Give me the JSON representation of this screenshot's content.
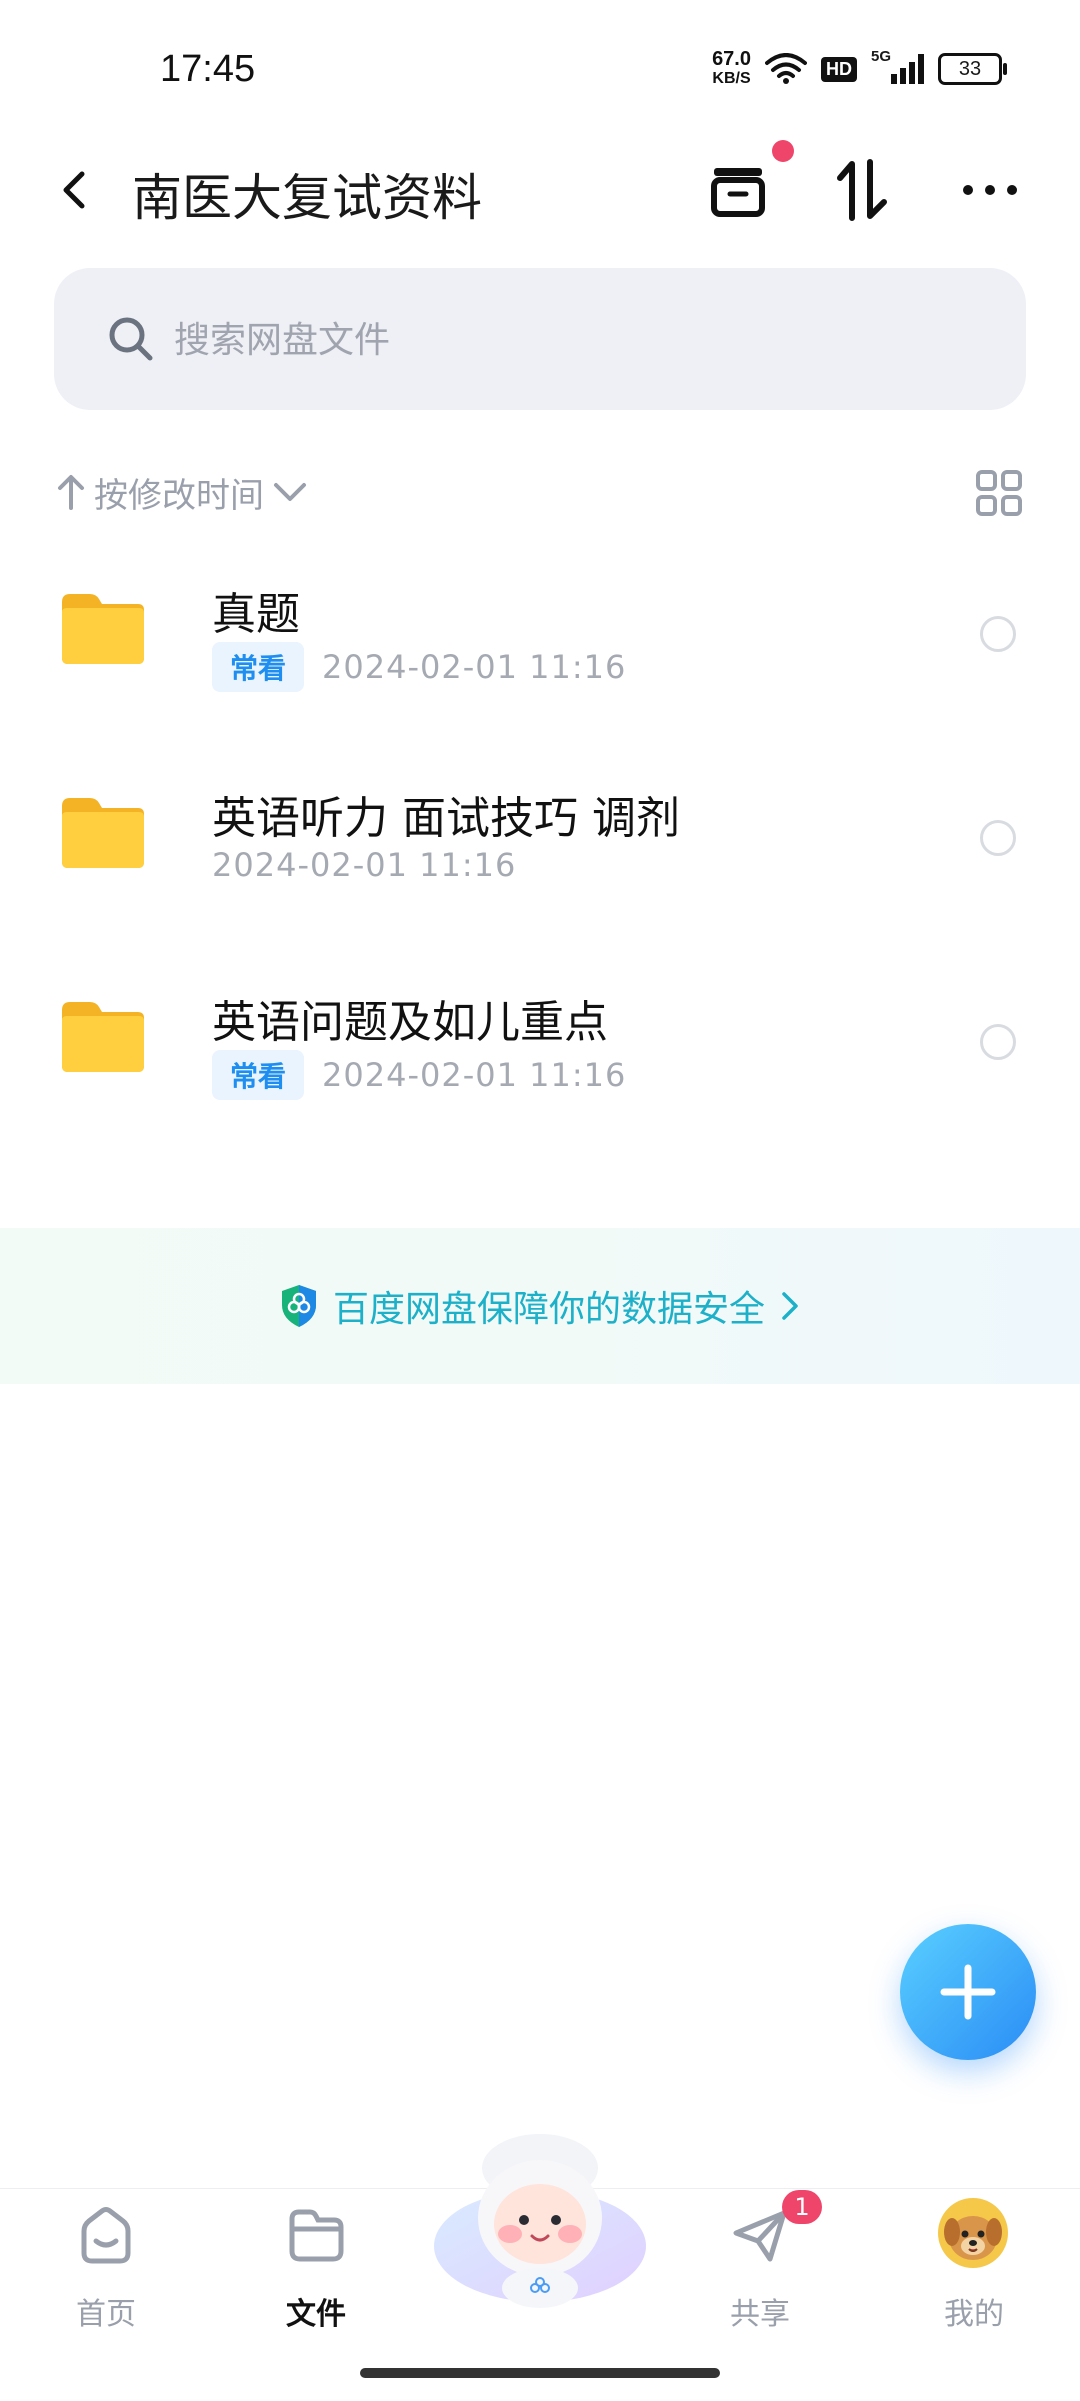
{
  "status_bar": {
    "time": "17:45",
    "net_speed": "67.0",
    "net_speed_unit": "KB/S",
    "hd_label": "HD",
    "signal_label": "5G",
    "battery": "33"
  },
  "header": {
    "title": "南医大复试资料",
    "icons": [
      "back-icon",
      "archive-icon",
      "sort-arrows-icon",
      "more-icon"
    ]
  },
  "search": {
    "placeholder": "搜索网盘文件"
  },
  "sort": {
    "label": "按修改时间"
  },
  "files": [
    {
      "name": "真题",
      "tag": "常看",
      "date": "2024-02-01  11:16"
    },
    {
      "name": "英语听力 面试技巧 调剂",
      "tag": "",
      "date": "2024-02-01  11:16"
    },
    {
      "name": "英语问题及如儿重点",
      "tag": "常看",
      "date": "2024-02-01  11:16"
    }
  ],
  "banner": {
    "text": "百度网盘保障你的数据安全"
  },
  "bottom_nav": {
    "home": "首页",
    "files": "文件",
    "share": "共享",
    "share_badge": "1",
    "mine": "我的"
  },
  "colors": {
    "accent": "#2a8cf5",
    "badge": "#f0456a",
    "folder": "#ffc93a",
    "tag_text": "#1f8ef1",
    "banner_text": "#1cb0c9"
  }
}
